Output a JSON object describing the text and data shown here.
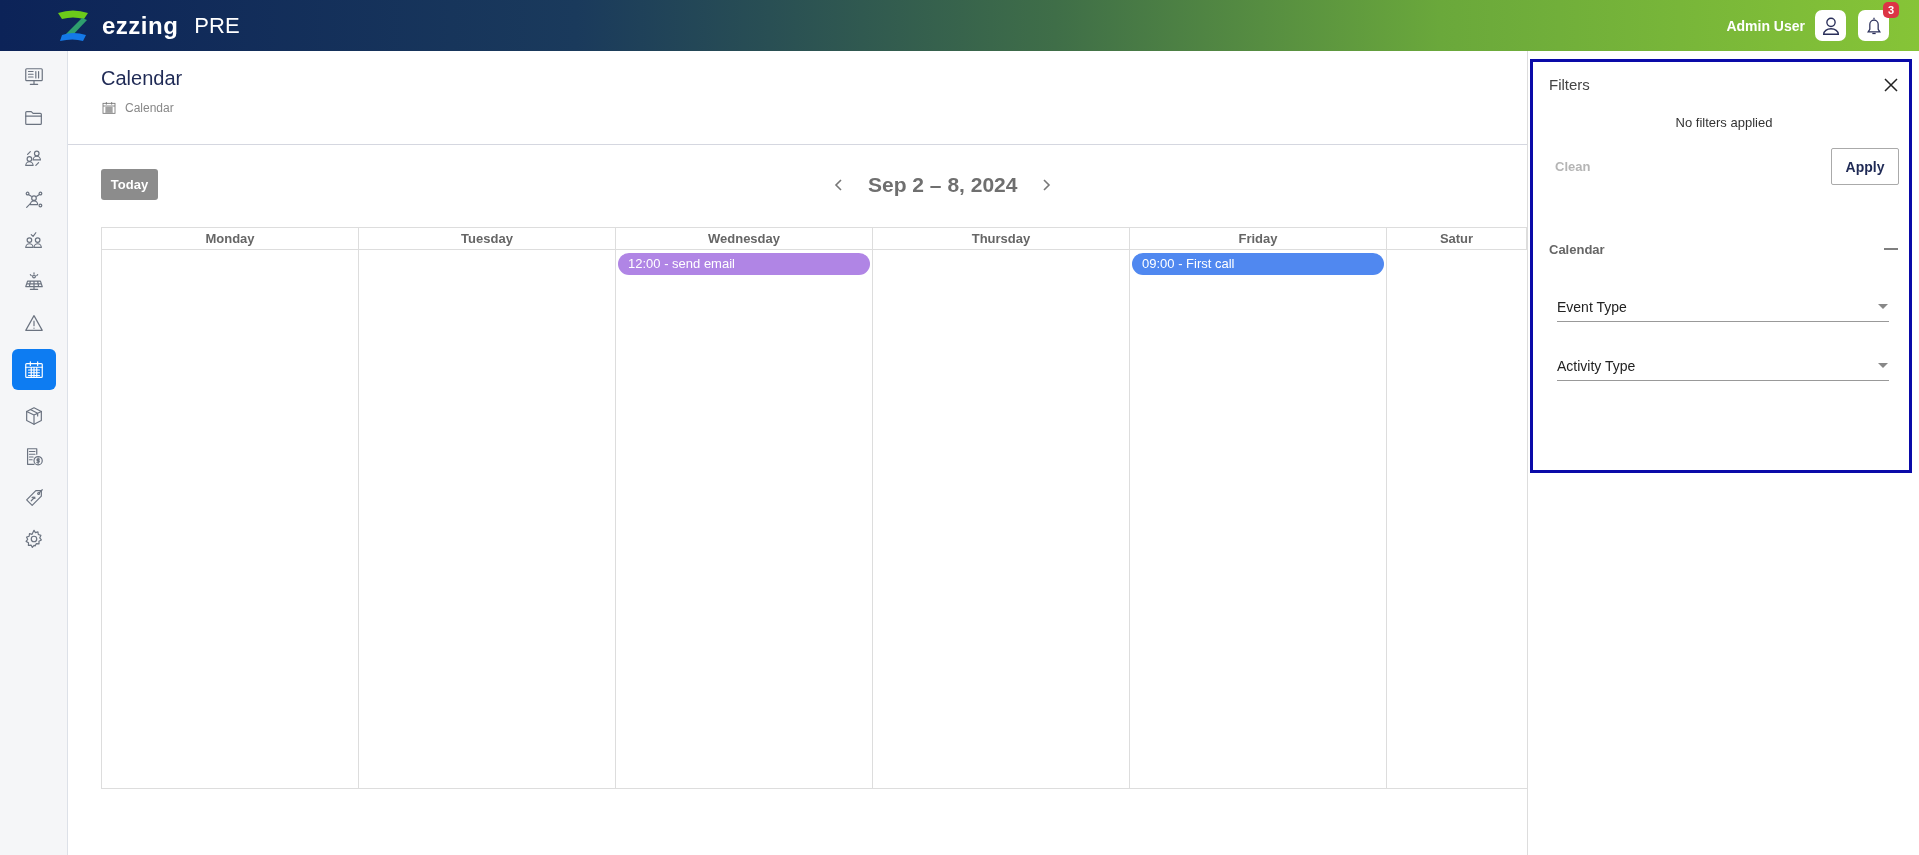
{
  "header": {
    "brand": "ezzing",
    "environment": "PRE",
    "user": "Admin User",
    "notifications": "3"
  },
  "sidebar": {
    "items": [
      {
        "selected": false
      },
      {
        "selected": false
      },
      {
        "selected": false
      },
      {
        "selected": false
      },
      {
        "selected": false
      },
      {
        "selected": false
      },
      {
        "selected": false
      },
      {
        "selected": true
      },
      {
        "selected": false
      },
      {
        "selected": false
      },
      {
        "selected": false
      },
      {
        "selected": false
      }
    ]
  },
  "page": {
    "title": "Calendar",
    "breadcrumb": "Calendar"
  },
  "calendar": {
    "today": {
      "label": "Today",
      "disabled": true
    },
    "range": "Sep 2 – 8, 2024",
    "days": [
      {
        "name": "Monday"
      },
      {
        "name": "Tuesday"
      },
      {
        "name": "Wednesday",
        "events": [
          {
            "label": "12:00 - send email",
            "color": "#b085e5"
          }
        ]
      },
      {
        "name": "Thursday"
      },
      {
        "name": "Friday",
        "events": [
          {
            "label": "09:00 - First call",
            "color": "#5088f0"
          }
        ]
      },
      {
        "name": "Satur"
      }
    ]
  },
  "filters": {
    "title": "Filters",
    "status": "No filters applied",
    "clean": {
      "label": "Clean",
      "disabled": true
    },
    "apply": "Apply",
    "section": {
      "title": "Calendar",
      "expanded": true,
      "fields": [
        {
          "label": "Event Type"
        },
        {
          "label": "Activity Type"
        }
      ]
    }
  }
}
